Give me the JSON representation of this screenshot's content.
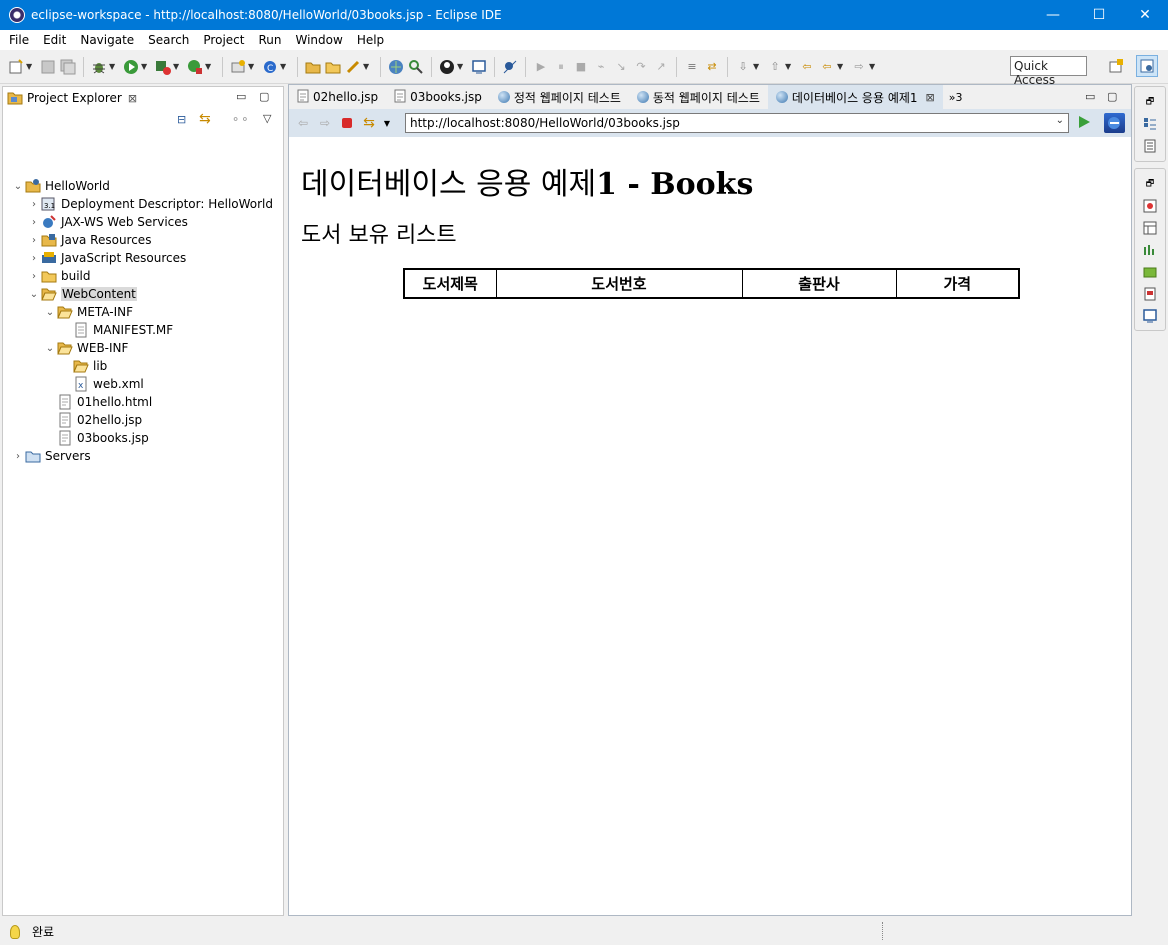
{
  "window": {
    "title": "eclipse-workspace - http://localhost:8080/HelloWorld/03books.jsp - Eclipse IDE",
    "minimize": "—",
    "maximize": "☐",
    "close": "✕"
  },
  "menu": [
    "File",
    "Edit",
    "Navigate",
    "Search",
    "Project",
    "Run",
    "Window",
    "Help"
  ],
  "toolbar": {
    "quick_access": "Quick Access"
  },
  "explorer": {
    "title": "Project Explorer",
    "tree": [
      {
        "label": "HelloWorld",
        "icon": "project-icon",
        "arrow": "⌄"
      },
      {
        "label": "Deployment Descriptor: HelloWorld",
        "icon": "deployment-descriptor-icon",
        "arrow": "›"
      },
      {
        "label": "JAX-WS Web Services",
        "icon": "web-services-icon",
        "arrow": "›"
      },
      {
        "label": "Java Resources",
        "icon": "java-resources-icon",
        "arrow": "›"
      },
      {
        "label": "JavaScript Resources",
        "icon": "javascript-resources-icon",
        "arrow": "›"
      },
      {
        "label": "build",
        "icon": "folder-icon",
        "arrow": "›"
      },
      {
        "label": "WebContent",
        "icon": "folder-open-icon",
        "arrow": "⌄"
      },
      {
        "label": "META-INF",
        "icon": "folder-open-icon",
        "arrow": "⌄"
      },
      {
        "label": "MANIFEST.MF",
        "icon": "file-icon",
        "arrow": ""
      },
      {
        "label": "WEB-INF",
        "icon": "folder-open-icon",
        "arrow": "⌄"
      },
      {
        "label": "lib",
        "icon": "folder-open-icon",
        "arrow": ""
      },
      {
        "label": "web.xml",
        "icon": "xml-file-icon",
        "arrow": ""
      },
      {
        "label": "01hello.html",
        "icon": "html-file-icon",
        "arrow": ""
      },
      {
        "label": "02hello.jsp",
        "icon": "jsp-file-icon",
        "arrow": ""
      },
      {
        "label": "03books.jsp",
        "icon": "jsp-file-icon",
        "arrow": ""
      },
      {
        "label": "Servers",
        "icon": "servers-folder-icon",
        "arrow": "›"
      }
    ]
  },
  "editor": {
    "tabs": [
      {
        "label": "02hello.jsp",
        "icon": "jsp-file-icon"
      },
      {
        "label": "03books.jsp",
        "icon": "jsp-file-icon"
      },
      {
        "label": "정적 웹페이지 테스트",
        "icon": "globe-icon"
      },
      {
        "label": "동적 웹페이지 테스트",
        "icon": "globe-icon"
      },
      {
        "label": "데이터베이스 응용 예제1",
        "icon": "globe-icon"
      }
    ],
    "overflow_count": "»3",
    "url": "http://localhost:8080/HelloWorld/03books.jsp"
  },
  "page": {
    "heading_korean": "데이터베이스 응용 예제",
    "heading_bold": "1 - Books",
    "subheading": "도서 보유 리스트",
    "table_headers": [
      "도서제목",
      "도서번호",
      "출판사",
      "가격"
    ]
  },
  "status": {
    "text": "완료"
  }
}
